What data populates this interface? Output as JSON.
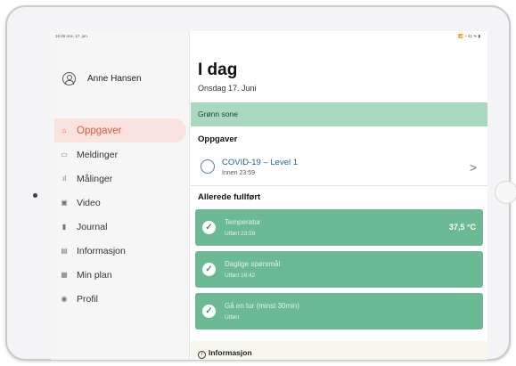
{
  "status_bar": {
    "left_text": "16:49  ons. 17. jun.",
    "right_text": "📶 ◔ 41 % ▮"
  },
  "sidebar": {
    "user_name": "Anne Hansen",
    "items": [
      {
        "label": "Oppgaver",
        "icon": "home-icon",
        "glyph": "⌂",
        "active": true
      },
      {
        "label": "Meldinger",
        "icon": "messages-icon",
        "glyph": "▭"
      },
      {
        "label": "Målinger",
        "icon": "measurements-icon",
        "glyph": "ıl"
      },
      {
        "label": "Video",
        "icon": "video-icon",
        "glyph": "▣"
      },
      {
        "label": "Journal",
        "icon": "journal-icon",
        "glyph": "▮"
      },
      {
        "label": "Informasjon",
        "icon": "information-icon",
        "glyph": "▤"
      },
      {
        "label": "Min plan",
        "icon": "plan-icon",
        "glyph": "▦"
      },
      {
        "label": "Profil",
        "icon": "profile-icon",
        "glyph": "◉"
      }
    ]
  },
  "main": {
    "title": "I dag",
    "date": "Onsdag 17. Juni",
    "zone": "Grønn sone",
    "tasks_heading": "Oppgaver",
    "task": {
      "title": "COVID-19 – Level 1",
      "deadline": "Innen 23:59"
    },
    "completed_heading": "Allerede fullført",
    "completed": [
      {
        "title": "Temperatur",
        "sub": "Utført 23:59",
        "value": "37,5 °C"
      },
      {
        "title": "Daglige spørsmål",
        "sub": "Utført 16:42",
        "value": ""
      },
      {
        "title": "Gå en tur (minst 30min)",
        "sub": "Utført",
        "value": ""
      }
    ],
    "info_label": "Informasjon"
  },
  "colors": {
    "accent": "#e0593f",
    "zone_green": "#a9d8bf",
    "card_green": "#6cba94",
    "link_blue": "#1f5f9e"
  }
}
